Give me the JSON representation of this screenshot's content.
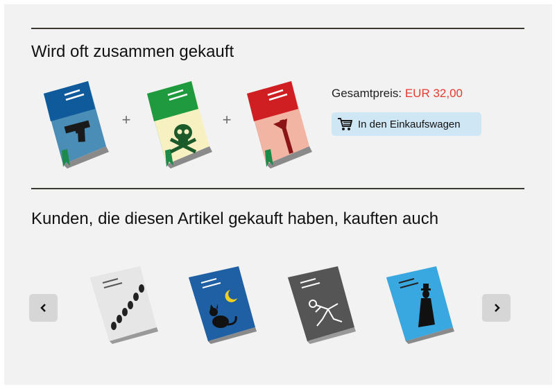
{
  "fbt": {
    "title": "Wird oft zusammen gekauft",
    "plus_1": "+",
    "plus_2": "+",
    "total_label": "Gesamtpreis:",
    "total_price": "EUR 32,00",
    "add_to_cart_label": "In den Einkaufswagen",
    "books": [
      {
        "icon": "gun-icon",
        "cover_color": "#4a8db7",
        "header_color": "#0e5a9a"
      },
      {
        "icon": "skull-crossbones-icon",
        "cover_color": "#f7f1c2",
        "header_color": "#1f9a3e"
      },
      {
        "icon": "axe-icon",
        "cover_color": "#f2b5a4",
        "header_color": "#cf1f22"
      }
    ]
  },
  "recommendations": {
    "title": "Kunden, die diesen Artikel gekauft haben, kauften auch",
    "prev_icon": "chevron-left-icon",
    "next_icon": "chevron-right-icon",
    "books": [
      {
        "icon": "footprints-icon",
        "cover_color": "#e6e6e6"
      },
      {
        "icon": "cat-moon-icon",
        "cover_color": "#1f5fa3"
      },
      {
        "icon": "chalk-outline-icon",
        "cover_color": "#555555"
      },
      {
        "icon": "detective-silhouette-icon",
        "cover_color": "#39a7e0"
      }
    ]
  },
  "colors": {
    "price": "#e53a2e",
    "button_bg": "#cfe7f4",
    "panel_bg": "#f2f2f2"
  }
}
